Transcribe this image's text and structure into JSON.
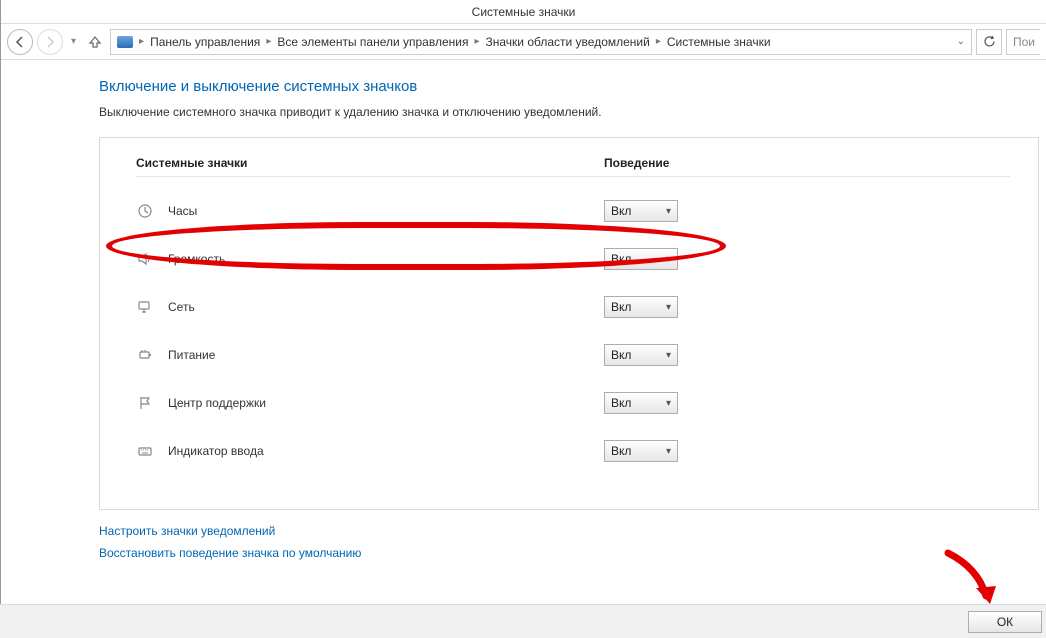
{
  "window_title": "Системные значки",
  "nav": {
    "search_placeholder": "Пои"
  },
  "breadcrumbs": [
    "Панель управления",
    "Все элементы панели управления",
    "Значки области уведомлений",
    "Системные значки"
  ],
  "page": {
    "title": "Включение и выключение системных значков",
    "description": "Выключение системного значка приводит к удалению значка и отключению уведомлений."
  },
  "columns": {
    "name": "Системные значки",
    "behavior": "Поведение"
  },
  "rows": [
    {
      "icon": "clock-icon",
      "label": "Часы",
      "value": "Вкл"
    },
    {
      "icon": "volume-icon",
      "label": "Громкость",
      "value": "Вкл"
    },
    {
      "icon": "network-icon",
      "label": "Сеть",
      "value": "Вкл"
    },
    {
      "icon": "power-icon",
      "label": "Питание",
      "value": "Вкл"
    },
    {
      "icon": "flag-icon",
      "label": "Центр поддержки",
      "value": "Вкл"
    },
    {
      "icon": "keyboard-icon",
      "label": "Индикатор ввода",
      "value": "Вкл"
    }
  ],
  "links": {
    "customize": "Настроить значки уведомлений",
    "restore": "Восстановить поведение значка по умолчанию"
  },
  "buttons": {
    "ok": "ОК"
  }
}
